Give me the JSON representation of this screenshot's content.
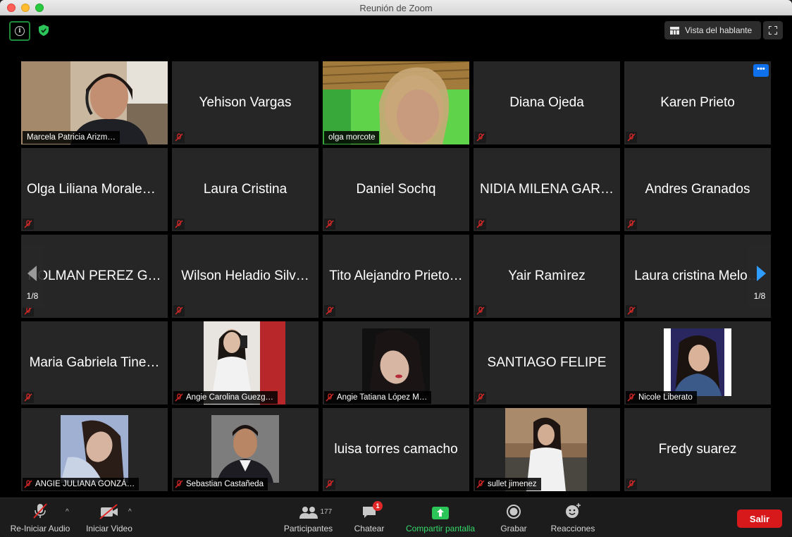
{
  "window": {
    "title": "Reunión de Zoom"
  },
  "topbar": {
    "speaker_view_label": "Vista del hablante"
  },
  "pager": {
    "left_label": "1/8",
    "right_label": "1/8"
  },
  "tiles": [
    {
      "name": "Marcela Patricia Arizm…",
      "type": "video"
    },
    {
      "name": "Yehison Vargas",
      "type": "name"
    },
    {
      "name": "olga morcote",
      "type": "video",
      "active": true
    },
    {
      "name": "Diana Ojeda",
      "type": "name"
    },
    {
      "name": "Karen Prieto",
      "type": "name"
    },
    {
      "name": "Olga Liliana Morales…",
      "type": "name"
    },
    {
      "name": "Laura Cristina",
      "type": "name"
    },
    {
      "name": "Daniel Sochq",
      "type": "name"
    },
    {
      "name": "NIDIA MILENA GAR…",
      "type": "name"
    },
    {
      "name": "Andres Granados",
      "type": "name"
    },
    {
      "name": "HOLMAN PEREZ G…",
      "type": "name"
    },
    {
      "name": "Wilson Heladio Silv…",
      "type": "name"
    },
    {
      "name": "Tito Alejandro Prieto…",
      "type": "name"
    },
    {
      "name": "Yair Ramìrez",
      "type": "name"
    },
    {
      "name": "Laura cristina Melo…",
      "type": "name"
    },
    {
      "name": "Maria Gabriela Tine…",
      "type": "name"
    },
    {
      "name": "Angie Carolina Guezg…",
      "type": "photo"
    },
    {
      "name": "Angie Tatiana López M…",
      "type": "photo"
    },
    {
      "name": "SANTIAGO FELIPE",
      "type": "name"
    },
    {
      "name": "Nicole Liberato",
      "type": "photo"
    },
    {
      "name": "ANGIE JULIANA GONZÁ…",
      "type": "photo"
    },
    {
      "name": "Sebastian Castañeda",
      "type": "photo"
    },
    {
      "name": "luisa torres camacho",
      "type": "name"
    },
    {
      "name": "sullet jimenez",
      "type": "photo"
    },
    {
      "name": "Fredy suarez",
      "type": "name"
    }
  ],
  "toolbar": {
    "audio_label": "Re-Iniciar Audio",
    "video_label": "Iniciar Video",
    "participants_label": "Participantes",
    "participants_count": "177",
    "chat_label": "Chatear",
    "chat_badge": "1",
    "share_label": "Compartir pantalla",
    "record_label": "Grabar",
    "reactions_label": "Reacciones",
    "leave_label": "Salir"
  },
  "colors": {
    "share_green": "#36d96b",
    "leave_red": "#d7191c",
    "active_speaker": "#e8ec8b",
    "accent_blue": "#0e71eb"
  }
}
